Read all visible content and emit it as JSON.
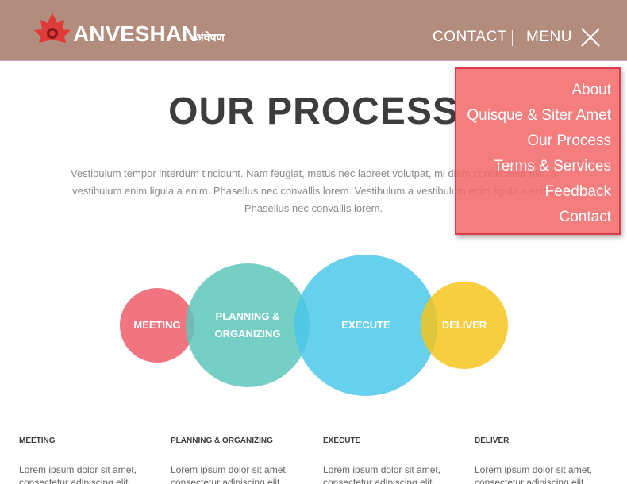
{
  "header": {
    "brand": "ANVESHAN",
    "brand_hindi": "अंवेषण",
    "contact_label": "CONTACT",
    "menu_label": "MENU",
    "colors": {
      "bar": "#b28c7d",
      "logo": "#e03b3b"
    }
  },
  "dropdown": {
    "items": [
      {
        "label": "About"
      },
      {
        "label": "Quisque & Siter Amet"
      },
      {
        "label": "Our Process"
      },
      {
        "label": "Terms & Services"
      },
      {
        "label": "Feedback"
      },
      {
        "label": "Contact"
      }
    ],
    "color": "#f26868"
  },
  "main": {
    "title": "OUR PROCESS",
    "intro": "Vestibulum tempor interdum tincidunt. Nam feugiat, metus nec laoreet volutpat, mi diam consectetur nisl, a vestibulum enim ligula a enim. Phasellus nec convallis lorem. Vestibulum a vestibulum enim ligula a enim. Phasellus nec convallis lorem.",
    "steps": [
      {
        "label": "MEETING",
        "color": "#ef6270"
      },
      {
        "label": "PLANNING & ORGANIZING",
        "color": "#5ec7bb"
      },
      {
        "label": "EXECUTE",
        "color": "#4cc8e9"
      },
      {
        "label": "DELIVER",
        "color": "#f4c61e"
      }
    ],
    "columns": [
      {
        "heading": "MEETING",
        "text": "Lorem ipsum dolor sit amet, consectetur adipiscing elit."
      },
      {
        "heading": "PLANNING & ORGANIZING",
        "text": "Lorem ipsum dolor sit amet, consectetur adipiscing elit."
      },
      {
        "heading": "EXECUTE",
        "text": "Lorem ipsum dolor sit amet, consectetur adipiscing elit."
      },
      {
        "heading": "DELIVER",
        "text": "Lorem ipsum dolor sit amet, consectetur adipiscing elit."
      }
    ]
  },
  "icons": {
    "logo": "maple-leaf-logo-icon",
    "close": "close-icon"
  }
}
